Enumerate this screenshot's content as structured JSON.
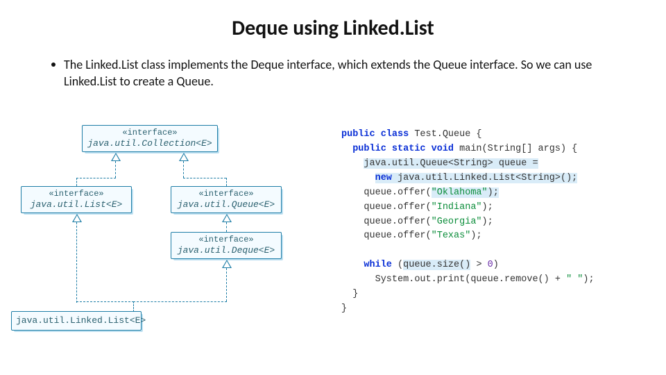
{
  "title": "Deque using Linked.List",
  "bullet_text": "The Linked.List class implements the Deque interface, which extends the Queue interface. So we can use Linked.List to create a Queue.",
  "uml": {
    "stereotype": "«interface»",
    "collection": "java.util.Collection<E>",
    "list": "java.util.List<E>",
    "queue": "java.util.Queue<E>",
    "deque": "java.util.Deque<E>",
    "linkedlist": "java.util.Linked.List<E>"
  },
  "code": {
    "l1a": "public class",
    "l1b": " Test.Queue {",
    "l2a": "public static void",
    "l2b": " main(String[] args) {",
    "l3a": "java.util.Queue<String> queue =",
    "l4a": "new",
    "l4b": " java.util.Linked.List<String>();",
    "l5a": "queue.offer(",
    "l5b": "\"Oklahoma\"",
    "l5c": ");",
    "l6a": "queue.offer(",
    "l6b": "\"Indiana\"",
    "l6c": ");",
    "l7a": "queue.offer(",
    "l7b": "\"Georgia\"",
    "l7c": ");",
    "l8a": "queue.offer(",
    "l8b": "\"Texas\"",
    "l8c": ");",
    "l9a": "while",
    "l9b": " (",
    "l9c": "queue.size()",
    "l9d": " > ",
    "l9e": "0",
    "l9f": ")",
    "l10a": "System.out.print(queue.remove() + ",
    "l10b": "\" \"",
    "l10c": ");",
    "l11": "}",
    "l12": "}"
  }
}
